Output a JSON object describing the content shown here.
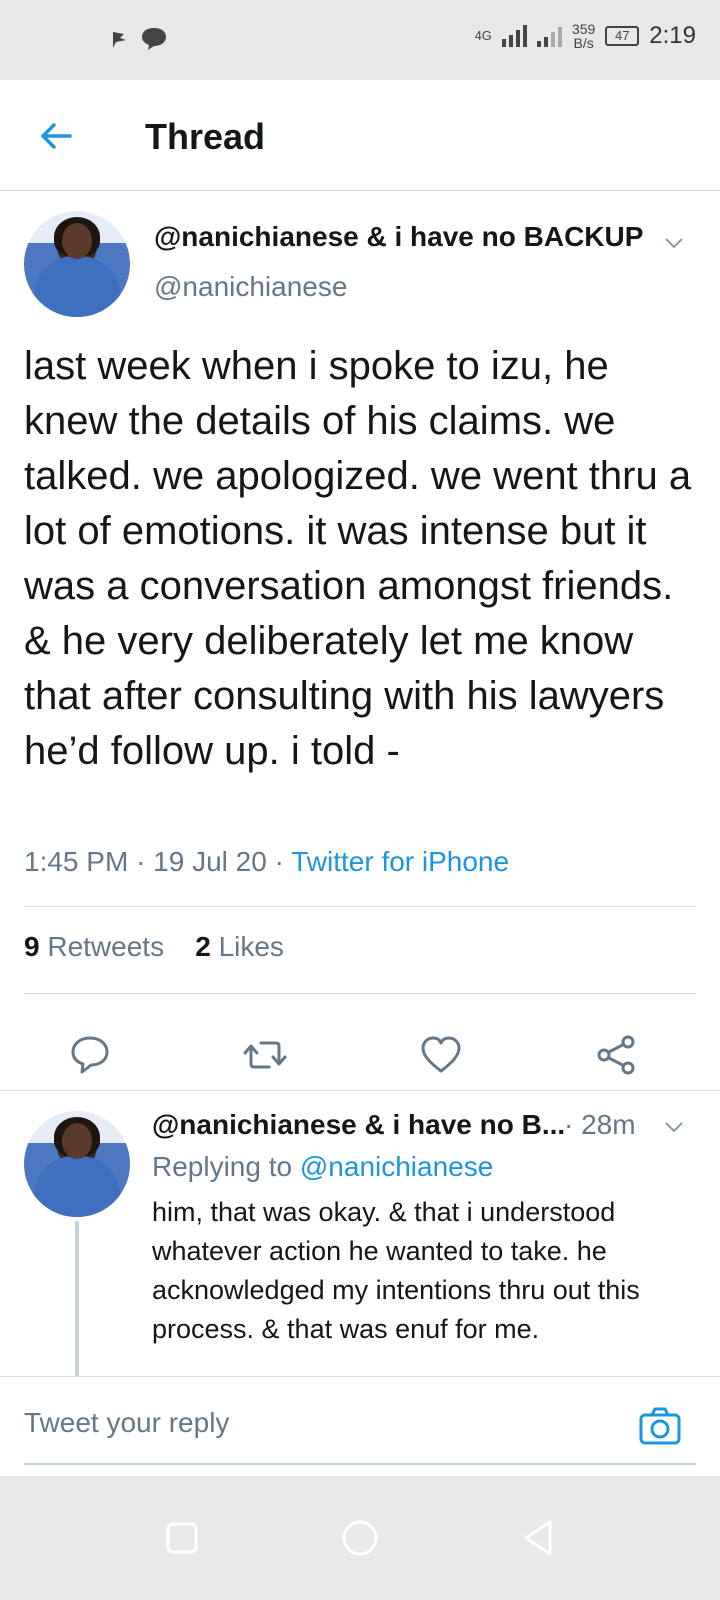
{
  "status_bar": {
    "network": "4G",
    "speed_value": "359",
    "speed_unit": "B/s",
    "battery": "47",
    "time": "2:19"
  },
  "header": {
    "title": "Thread"
  },
  "tweet": {
    "display_name": "@nanichianese & i have no BACKUP",
    "handle": "@nanichianese",
    "text": "last week when i spoke to izu, he knew the details of his claims. we talked. we apologized. we went thru a lot of emotions. it was intense but it was a conversation amongst friends. & he very deliberately let me know that after consulting with his lawyers he’d follow up. i told -",
    "time": "1:45 PM",
    "date": "19 Jul 20",
    "source": "Twitter for iPhone",
    "retweets_count": "9",
    "retweets_label": "Retweets",
    "likes_count": "2",
    "likes_label": "Likes"
  },
  "reply": {
    "display_name": "@nanichianese & i have no B...",
    "time": "28m",
    "replying_prefix": "Replying to",
    "replying_to": "@nanichianese",
    "text": "him, that was okay. & that i understood whatever action he wanted to take. he acknowledged my intentions thru out this process. & that was enuf for me."
  },
  "compose": {
    "placeholder": "Tweet your reply"
  },
  "colors": {
    "accent": "#1b95e0",
    "text": "#14171a",
    "muted": "#657786"
  }
}
